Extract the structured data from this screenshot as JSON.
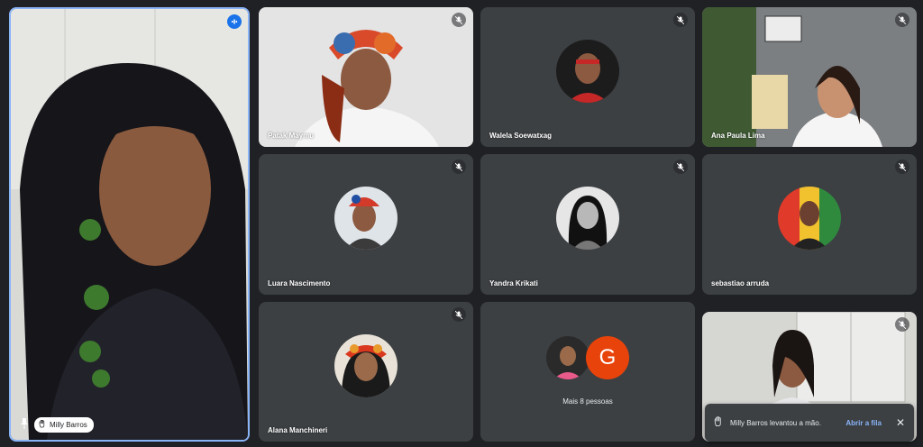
{
  "colors": {
    "background": "#202124",
    "tile": "#3c4043",
    "active_border": "#8ab4f8",
    "active_speaker": "#1a73e8",
    "g_avatar": "#e8430b",
    "link": "#8ab4f8"
  },
  "spotlight": {
    "name": "Milly Barros",
    "pin_icon": "pin-icon",
    "hand_icon": "hand-raised-icon"
  },
  "participants": [
    {
      "name": "Patak Maymu",
      "muted": true
    },
    {
      "name": "Walela Soewatxag",
      "muted": true
    },
    {
      "name": "Ana Paula Lima",
      "muted": true
    },
    {
      "name": "Luara Nascimento",
      "muted": true
    },
    {
      "name": "Yandra Krikati",
      "muted": true
    },
    {
      "name": "sebastiao arruda",
      "muted": true
    },
    {
      "name": "Alana Manchineri",
      "muted": true
    }
  ],
  "group_tile": {
    "avatar_letter": "G",
    "label": "Mais 8 pessoas"
  },
  "toast": {
    "message": "Milly Barros levantou a mão.",
    "action": "Abrir a fila",
    "close": "✕"
  }
}
